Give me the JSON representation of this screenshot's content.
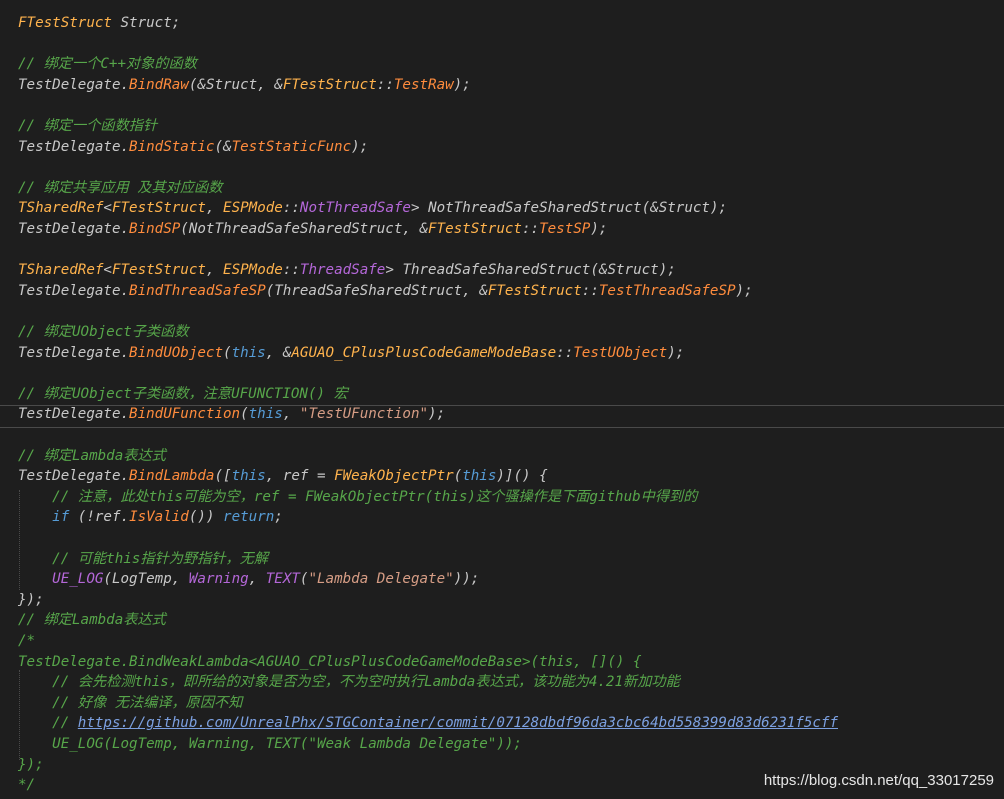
{
  "lines": [
    "FTestStruct Struct;",
    "",
    "// 绑定一个C++对象的函数",
    "TestDelegate.BindRaw(&Struct, &FTestStruct::TestRaw);",
    "",
    "// 绑定一个函数指针",
    "TestDelegate.BindStatic(&TestStaticFunc);",
    "",
    "// 绑定共享应用 及其对应函数",
    "TSharedRef<FTestStruct, ESPMode::NotThreadSafe> NotThreadSafeSharedStruct(&Struct);",
    "TestDelegate.BindSP(NotThreadSafeSharedStruct, &FTestStruct::TestSP);",
    "",
    "TSharedRef<FTestStruct, ESPMode::ThreadSafe> ThreadSafeSharedStruct(&Struct);",
    "TestDelegate.BindThreadSafeSP(ThreadSafeSharedStruct, &FTestStruct::TestThreadSafeSP);",
    "",
    "// 绑定UObject子类函数",
    "TestDelegate.BindUObject(this, &AGUAO_CPlusPlusCodeGameModeBase::TestUObject);",
    "",
    "// 绑定UObject子类函数，注意UFUNCTION() 宏",
    "TestDelegate.BindUFunction(this, \"TestUFunction\");",
    "",
    "// 绑定Lambda表达式",
    "TestDelegate.BindLambda([this, ref = FWeakObjectPtr(this)]() {",
    "    // 注意，此处this可能为空，ref = FWeakObjectPtr(this)这个骚操作是下面github中得到的",
    "    if (!ref.IsValid()) return;",
    "",
    "    // 可能this指针为野指针，无解",
    "    UE_LOG(LogTemp, Warning, TEXT(\"Lambda Delegate\"));",
    "});",
    "// 绑定Lambda表达式",
    "/*",
    "TestDelegate.BindWeakLambda<AGUAO_CPlusPlusCodeGameModeBase>(this, []() {",
    "    // 会先检测this，即所给的对象是否为空，不为空时执行Lambda表达式，该功能为4.21新加功能",
    "    // 好像 无法编译，原因不知",
    "    // https://github.com/UnrealPhx/STGContainer/commit/07128dbdf96da3cbc64bd558399d83d6231f5cff",
    "    UE_LOG(LogTemp, Warning, TEXT(\"Weak Lambda Delegate\"));",
    "});",
    "*/"
  ],
  "watermark": "https://blog.csdn.net/qq_33017259",
  "colors": {
    "background": "#1e1e1e",
    "type": "#ffb34d",
    "function": "#ff8c3d",
    "comment": "#57a64a",
    "keyword": "#569cd6",
    "enum": "#b467d8",
    "string": "#d69d85"
  }
}
